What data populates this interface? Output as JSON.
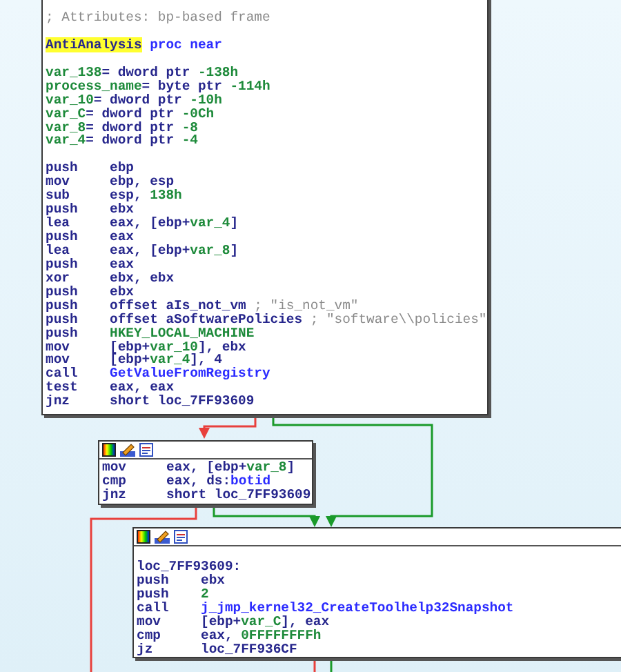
{
  "blocks": [
    {
      "toolbar": false,
      "lines": [
        {
          "kind": "text",
          "segments": [
            {
              "text": "; Attributes: bp-based frame",
              "kind": "comment"
            }
          ]
        },
        {
          "kind": "blank"
        },
        {
          "kind": "text",
          "segments": [
            {
              "text": "AntiAnalysis",
              "kind": "highlight"
            },
            {
              "text": " proc near",
              "kind": "name"
            }
          ]
        },
        {
          "kind": "blank"
        },
        {
          "kind": "text",
          "segments": [
            {
              "text": "var_138",
              "kind": "var"
            },
            {
              "text": "= dword ptr ",
              "kind": "plain"
            },
            {
              "text": "-138h",
              "kind": "num"
            }
          ]
        },
        {
          "kind": "text",
          "segments": [
            {
              "text": "process_name",
              "kind": "var"
            },
            {
              "text": "= byte ptr ",
              "kind": "plain"
            },
            {
              "text": "-114h",
              "kind": "num"
            }
          ]
        },
        {
          "kind": "text",
          "segments": [
            {
              "text": "var_10",
              "kind": "var"
            },
            {
              "text": "= dword ptr ",
              "kind": "plain"
            },
            {
              "text": "-10h",
              "kind": "num"
            }
          ]
        },
        {
          "kind": "text",
          "segments": [
            {
              "text": "var_C",
              "kind": "var"
            },
            {
              "text": "= dword ptr ",
              "kind": "plain"
            },
            {
              "text": "-0Ch",
              "kind": "num"
            }
          ]
        },
        {
          "kind": "text",
          "segments": [
            {
              "text": "var_8",
              "kind": "var"
            },
            {
              "text": "= dword ptr ",
              "kind": "plain"
            },
            {
              "text": "-8",
              "kind": "num"
            }
          ]
        },
        {
          "kind": "text",
          "segments": [
            {
              "text": "var_4",
              "kind": "var"
            },
            {
              "text": "= dword ptr ",
              "kind": "plain"
            },
            {
              "text": "-4",
              "kind": "num"
            }
          ]
        },
        {
          "kind": "blank"
        },
        {
          "kind": "insn",
          "op": "push",
          "segments": [
            {
              "text": "ebp",
              "kind": "plain"
            }
          ]
        },
        {
          "kind": "insn",
          "op": "mov",
          "segments": [
            {
              "text": "ebp, esp",
              "kind": "plain"
            }
          ]
        },
        {
          "kind": "insn",
          "op": "sub",
          "segments": [
            {
              "text": "esp, ",
              "kind": "plain"
            },
            {
              "text": "138h",
              "kind": "num"
            }
          ]
        },
        {
          "kind": "insn",
          "op": "push",
          "segments": [
            {
              "text": "ebx",
              "kind": "plain"
            }
          ]
        },
        {
          "kind": "insn",
          "op": "lea",
          "segments": [
            {
              "text": "eax, [ebp+",
              "kind": "plain"
            },
            {
              "text": "var_4",
              "kind": "var"
            },
            {
              "text": "]",
              "kind": "plain"
            }
          ]
        },
        {
          "kind": "insn",
          "op": "push",
          "segments": [
            {
              "text": "eax",
              "kind": "plain"
            }
          ]
        },
        {
          "kind": "insn",
          "op": "lea",
          "segments": [
            {
              "text": "eax, [ebp+",
              "kind": "plain"
            },
            {
              "text": "var_8",
              "kind": "var"
            },
            {
              "text": "]",
              "kind": "plain"
            }
          ]
        },
        {
          "kind": "insn",
          "op": "push",
          "segments": [
            {
              "text": "eax",
              "kind": "plain"
            }
          ]
        },
        {
          "kind": "insn",
          "op": "xor",
          "segments": [
            {
              "text": "ebx, ebx",
              "kind": "plain"
            }
          ]
        },
        {
          "kind": "insn",
          "op": "push",
          "segments": [
            {
              "text": "ebx",
              "kind": "plain"
            }
          ]
        },
        {
          "kind": "insn",
          "op": "push",
          "segments": [
            {
              "text": "offset aIs_not_vm",
              "kind": "plain"
            },
            {
              "text": " ; \"is_not_vm\"",
              "kind": "comment"
            }
          ]
        },
        {
          "kind": "insn",
          "op": "push",
          "segments": [
            {
              "text": "offset aSoftwarePolicies",
              "kind": "plain"
            },
            {
              "text": " ; \"software\\\\policies\"",
              "kind": "comment"
            }
          ]
        },
        {
          "kind": "insn",
          "op": "push",
          "segments": [
            {
              "text": "HKEY_LOCAL_MACHINE",
              "kind": "num"
            }
          ]
        },
        {
          "kind": "insn",
          "op": "mov",
          "segments": [
            {
              "text": "[ebp+",
              "kind": "plain"
            },
            {
              "text": "var_10",
              "kind": "var"
            },
            {
              "text": "], ebx",
              "kind": "plain"
            }
          ]
        },
        {
          "kind": "insn",
          "op": "mov",
          "segments": [
            {
              "text": "[ebp+",
              "kind": "plain"
            },
            {
              "text": "var_4",
              "kind": "var"
            },
            {
              "text": "], 4",
              "kind": "plain"
            }
          ]
        },
        {
          "kind": "insn",
          "op": "call",
          "segments": [
            {
              "text": "GetValueFromRegistry",
              "kind": "name"
            }
          ]
        },
        {
          "kind": "insn",
          "op": "test",
          "segments": [
            {
              "text": "eax, eax",
              "kind": "plain"
            }
          ]
        },
        {
          "kind": "insn",
          "op": "jnz",
          "segments": [
            {
              "text": "short loc_7FF93609",
              "kind": "plain"
            }
          ]
        }
      ]
    },
    {
      "toolbar": true,
      "lines": [
        {
          "kind": "insn",
          "op": "mov",
          "segments": [
            {
              "text": "eax, [ebp+",
              "kind": "plain"
            },
            {
              "text": "var_8",
              "kind": "var"
            },
            {
              "text": "]",
              "kind": "plain"
            }
          ]
        },
        {
          "kind": "insn",
          "op": "cmp",
          "segments": [
            {
              "text": "eax, ds:",
              "kind": "plain"
            },
            {
              "text": "botid",
              "kind": "name"
            }
          ]
        },
        {
          "kind": "insn",
          "op": "jnz",
          "segments": [
            {
              "text": "short loc_7FF93609",
              "kind": "plain"
            }
          ]
        }
      ]
    },
    {
      "toolbar": true,
      "lines": [
        {
          "kind": "blank"
        },
        {
          "kind": "text",
          "segments": [
            {
              "text": "loc_7FF93609:",
              "kind": "plain"
            }
          ]
        },
        {
          "kind": "insn",
          "op": "push",
          "segments": [
            {
              "text": "ebx",
              "kind": "plain"
            }
          ]
        },
        {
          "kind": "insn",
          "op": "push",
          "segments": [
            {
              "text": "2",
              "kind": "num"
            }
          ]
        },
        {
          "kind": "insn",
          "op": "call",
          "segments": [
            {
              "text": "j_jmp_kernel32_CreateToolhelp32Snapshot",
              "kind": "name"
            }
          ]
        },
        {
          "kind": "insn",
          "op": "mov",
          "segments": [
            {
              "text": "[ebp+",
              "kind": "plain"
            },
            {
              "text": "var_C",
              "kind": "var"
            },
            {
              "text": "], eax",
              "kind": "plain"
            }
          ]
        },
        {
          "kind": "insn",
          "op": "cmp",
          "segments": [
            {
              "text": "eax, ",
              "kind": "plain"
            },
            {
              "text": "0FFFFFFFFh",
              "kind": "num"
            }
          ]
        },
        {
          "kind": "insn",
          "op": "jz",
          "segments": [
            {
              "text": "loc_7FF936CF",
              "kind": "plain"
            }
          ]
        }
      ]
    }
  ],
  "edges": [
    {
      "color": "#e8403c"
    },
    {
      "color": "#1a9a2a"
    },
    {
      "color": "#1a9a2a"
    },
    {
      "color": "#e8403c"
    },
    {
      "color": "#e8403c"
    },
    {
      "color": "#1a9a2a"
    }
  ]
}
